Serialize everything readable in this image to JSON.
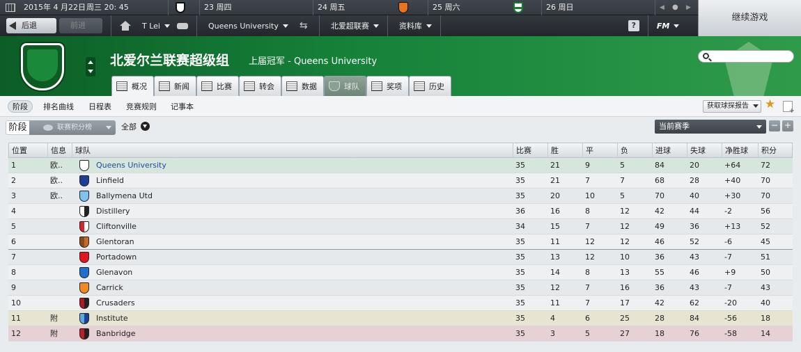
{
  "calendar": {
    "date": "2015年 4 月22日",
    "weekday_time": "周三 20: 45",
    "days": [
      {
        "label": "23 周四"
      },
      {
        "label": "24 周五"
      },
      {
        "label": "25 周六"
      },
      {
        "label": "26 周日"
      }
    ]
  },
  "nav": {
    "back": "后退",
    "forward": "前进",
    "manager": "T Lei",
    "club": "Queens University",
    "competition": "北爱超联赛",
    "database": "资料库",
    "help": "?",
    "fm": "FM"
  },
  "continue_label": "继续游戏",
  "header": {
    "title": "北爱尔兰联赛超级组",
    "champion_text": "上届冠军 - Queens University"
  },
  "tabs": [
    "概况",
    "新闻",
    "比赛",
    "转会",
    "数据",
    "球队",
    "奖项",
    "历史"
  ],
  "subnav": {
    "items": [
      "阶段",
      "排名曲线",
      "日程表",
      "竞赛规则",
      "记事本"
    ],
    "report_button": "获取球探报告"
  },
  "filter": {
    "stage_label": "阶段",
    "view": "联赛积分榜",
    "all": "全部",
    "season": "当前赛季",
    "minus": "−",
    "plus": "+"
  },
  "colors": {
    "champion_row": "#d6e6dc",
    "playoff_row": "#e8e4d2",
    "relegation_row": "#e6d2d5",
    "header_green": "#16823a"
  },
  "table": {
    "headers": [
      "位置",
      "信息",
      "球队",
      "比赛",
      "胜",
      "平",
      "负",
      "进球",
      "失球",
      "净胜球",
      "积分"
    ],
    "rows": [
      {
        "pos": "1",
        "info": "欧..",
        "team": "Queens University",
        "p": "35",
        "w": "21",
        "d": "9",
        "l": "5",
        "gf": "84",
        "ga": "20",
        "gd": "+64",
        "pts": "72",
        "crest": "#ffffff",
        "crest2": "#ffffff"
      },
      {
        "pos": "2",
        "info": "欧..",
        "team": "Linfield",
        "p": "35",
        "w": "21",
        "d": "7",
        "l": "7",
        "gf": "68",
        "ga": "28",
        "gd": "+40",
        "pts": "70",
        "crest": "#1d3f9a",
        "crest2": "#1d3f9a"
      },
      {
        "pos": "3",
        "info": "欧..",
        "team": "Ballymena Utd",
        "p": "35",
        "w": "20",
        "d": "10",
        "l": "5",
        "gf": "70",
        "ga": "40",
        "gd": "+30",
        "pts": "70",
        "crest": "#7cc4ef",
        "crest2": "#7cc4ef"
      },
      {
        "pos": "4",
        "info": "",
        "team": "Distillery",
        "p": "36",
        "w": "16",
        "d": "8",
        "l": "12",
        "gf": "42",
        "ga": "44",
        "gd": "-2",
        "pts": "56",
        "crest": "#ffffff",
        "crest2": "#222222"
      },
      {
        "pos": "5",
        "info": "",
        "team": "Cliftonville",
        "p": "34",
        "w": "15",
        "d": "7",
        "l": "12",
        "gf": "49",
        "ga": "36",
        "gd": "+13",
        "pts": "52",
        "crest": "#d7232a",
        "crest2": "#ffffff"
      },
      {
        "pos": "6",
        "info": "",
        "team": "Glentoran",
        "p": "35",
        "w": "11",
        "d": "12",
        "l": "12",
        "gf": "46",
        "ga": "52",
        "gd": "-6",
        "pts": "45",
        "crest": "#8a4a1c",
        "crest2": "#c56b2a"
      },
      {
        "pos": "7",
        "info": "",
        "team": "Portadown",
        "p": "35",
        "w": "13",
        "d": "12",
        "l": "10",
        "gf": "36",
        "ga": "43",
        "gd": "-7",
        "pts": "51",
        "crest": "#e3161d",
        "crest2": "#e3161d"
      },
      {
        "pos": "8",
        "info": "",
        "team": "Glenavon",
        "p": "35",
        "w": "14",
        "d": "8",
        "l": "13",
        "gf": "55",
        "ga": "46",
        "gd": "+9",
        "pts": "50",
        "crest": "#1e6fd1",
        "crest2": "#1e6fd1"
      },
      {
        "pos": "9",
        "info": "",
        "team": "Carrick",
        "p": "35",
        "w": "12",
        "d": "7",
        "l": "16",
        "gf": "36",
        "ga": "43",
        "gd": "-7",
        "pts": "43",
        "crest": "#f08a1c",
        "crest2": "#f08a1c"
      },
      {
        "pos": "10",
        "info": "",
        "team": "Crusaders",
        "p": "35",
        "w": "11",
        "d": "7",
        "l": "17",
        "gf": "42",
        "ga": "62",
        "gd": "-20",
        "pts": "40",
        "crest": "#b01822",
        "crest2": "#222222"
      },
      {
        "pos": "11",
        "info": "附",
        "team": "Institute",
        "p": "35",
        "w": "4",
        "d": "6",
        "l": "25",
        "gf": "28",
        "ga": "84",
        "gd": "-56",
        "pts": "18",
        "crest": "#5aa8e0",
        "crest2": "#1d3f9a"
      },
      {
        "pos": "12",
        "info": "附",
        "team": "Banbridge",
        "p": "35",
        "w": "3",
        "d": "5",
        "l": "27",
        "gf": "18",
        "ga": "76",
        "gd": "-58",
        "pts": "14",
        "crest": "#c01e26",
        "crest2": "#222222"
      }
    ]
  }
}
